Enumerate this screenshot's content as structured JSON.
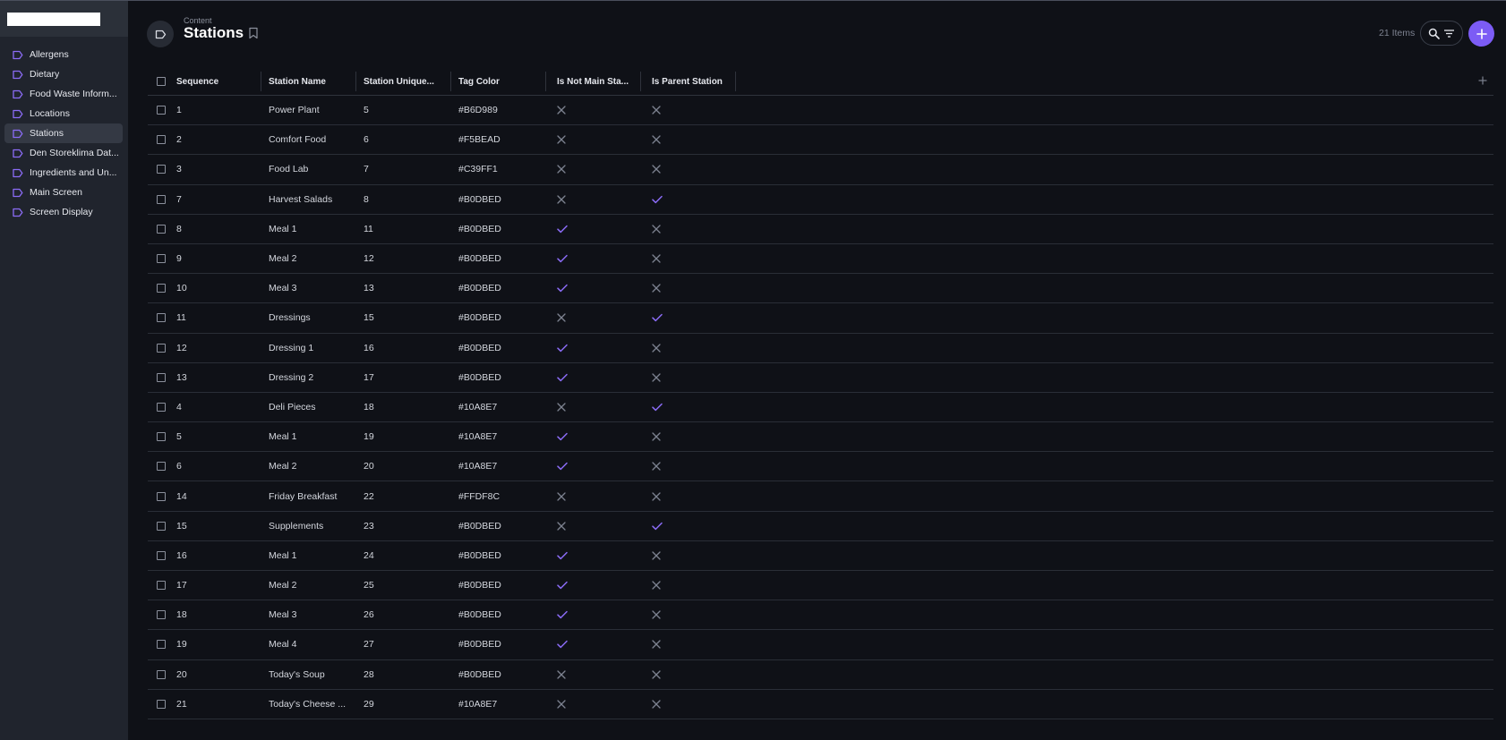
{
  "sidebar": {
    "items": [
      {
        "label": "Allergens",
        "active": false
      },
      {
        "label": "Dietary",
        "active": false
      },
      {
        "label": "Food Waste Inform...",
        "active": false
      },
      {
        "label": "Locations",
        "active": false
      },
      {
        "label": "Stations",
        "active": true
      },
      {
        "label": "Den Storeklima Dat...",
        "active": false
      },
      {
        "label": "Ingredients and Un...",
        "active": false
      },
      {
        "label": "Main Screen",
        "active": false
      },
      {
        "label": "Screen Display",
        "active": false
      }
    ]
  },
  "header": {
    "eyebrow": "Content",
    "title": "Stations",
    "items_count": "21 Items",
    "icons": [
      "collection-icon",
      "bookmark-icon",
      "search-icon",
      "filter-icon",
      "plus-icon"
    ]
  },
  "table": {
    "columns": [
      "Sequence",
      "Station Name",
      "Station Unique...",
      "Tag Color",
      "Is Not Main Sta...",
      "Is Parent Station"
    ],
    "rows": [
      {
        "seq": "1",
        "name": "Power Plant",
        "uid": "5",
        "tag": "#B6D989",
        "not_main": false,
        "parent": false
      },
      {
        "seq": "2",
        "name": "Comfort Food",
        "uid": "6",
        "tag": "#F5BEAD",
        "not_main": false,
        "parent": false
      },
      {
        "seq": "3",
        "name": "Food Lab",
        "uid": "7",
        "tag": "#C39FF1",
        "not_main": false,
        "parent": false
      },
      {
        "seq": "7",
        "name": "Harvest Salads",
        "uid": "8",
        "tag": "#B0DBED",
        "not_main": false,
        "parent": true
      },
      {
        "seq": "8",
        "name": "Meal 1",
        "uid": "11",
        "tag": "#B0DBED",
        "not_main": true,
        "parent": false
      },
      {
        "seq": "9",
        "name": "Meal 2",
        "uid": "12",
        "tag": "#B0DBED",
        "not_main": true,
        "parent": false
      },
      {
        "seq": "10",
        "name": "Meal 3",
        "uid": "13",
        "tag": "#B0DBED",
        "not_main": true,
        "parent": false
      },
      {
        "seq": "11",
        "name": "Dressings",
        "uid": "15",
        "tag": "#B0DBED",
        "not_main": false,
        "parent": true
      },
      {
        "seq": "12",
        "name": "Dressing 1",
        "uid": "16",
        "tag": "#B0DBED",
        "not_main": true,
        "parent": false
      },
      {
        "seq": "13",
        "name": "Dressing 2",
        "uid": "17",
        "tag": "#B0DBED",
        "not_main": true,
        "parent": false
      },
      {
        "seq": "4",
        "name": "Deli Pieces",
        "uid": "18",
        "tag": "#10A8E7",
        "not_main": false,
        "parent": true
      },
      {
        "seq": "5",
        "name": "Meal 1",
        "uid": "19",
        "tag": "#10A8E7",
        "not_main": true,
        "parent": false
      },
      {
        "seq": "6",
        "name": "Meal 2",
        "uid": "20",
        "tag": "#10A8E7",
        "not_main": true,
        "parent": false
      },
      {
        "seq": "14",
        "name": "Friday Breakfast",
        "uid": "22",
        "tag": "#FFDF8C",
        "not_main": false,
        "parent": false
      },
      {
        "seq": "15",
        "name": "Supplements",
        "uid": "23",
        "tag": "#B0DBED",
        "not_main": false,
        "parent": true
      },
      {
        "seq": "16",
        "name": "Meal 1",
        "uid": "24",
        "tag": "#B0DBED",
        "not_main": true,
        "parent": false
      },
      {
        "seq": "17",
        "name": "Meal 2",
        "uid": "25",
        "tag": "#B0DBED",
        "not_main": true,
        "parent": false
      },
      {
        "seq": "18",
        "name": "Meal 3",
        "uid": "26",
        "tag": "#B0DBED",
        "not_main": true,
        "parent": false
      },
      {
        "seq": "19",
        "name": "Meal 4",
        "uid": "27",
        "tag": "#B0DBED",
        "not_main": true,
        "parent": false
      },
      {
        "seq": "20",
        "name": "Today's Soup",
        "uid": "28",
        "tag": "#B0DBED",
        "not_main": false,
        "parent": false
      },
      {
        "seq": "21",
        "name": "Today's Cheese ...",
        "uid": "29",
        "tag": "#10A8E7",
        "not_main": false,
        "parent": false
      }
    ]
  },
  "colors": {
    "accent": "#7c5cf5",
    "check": "#8b6cf6",
    "cross": "#7d8290",
    "background": "#0f1117",
    "sidebar": "#20242d"
  }
}
